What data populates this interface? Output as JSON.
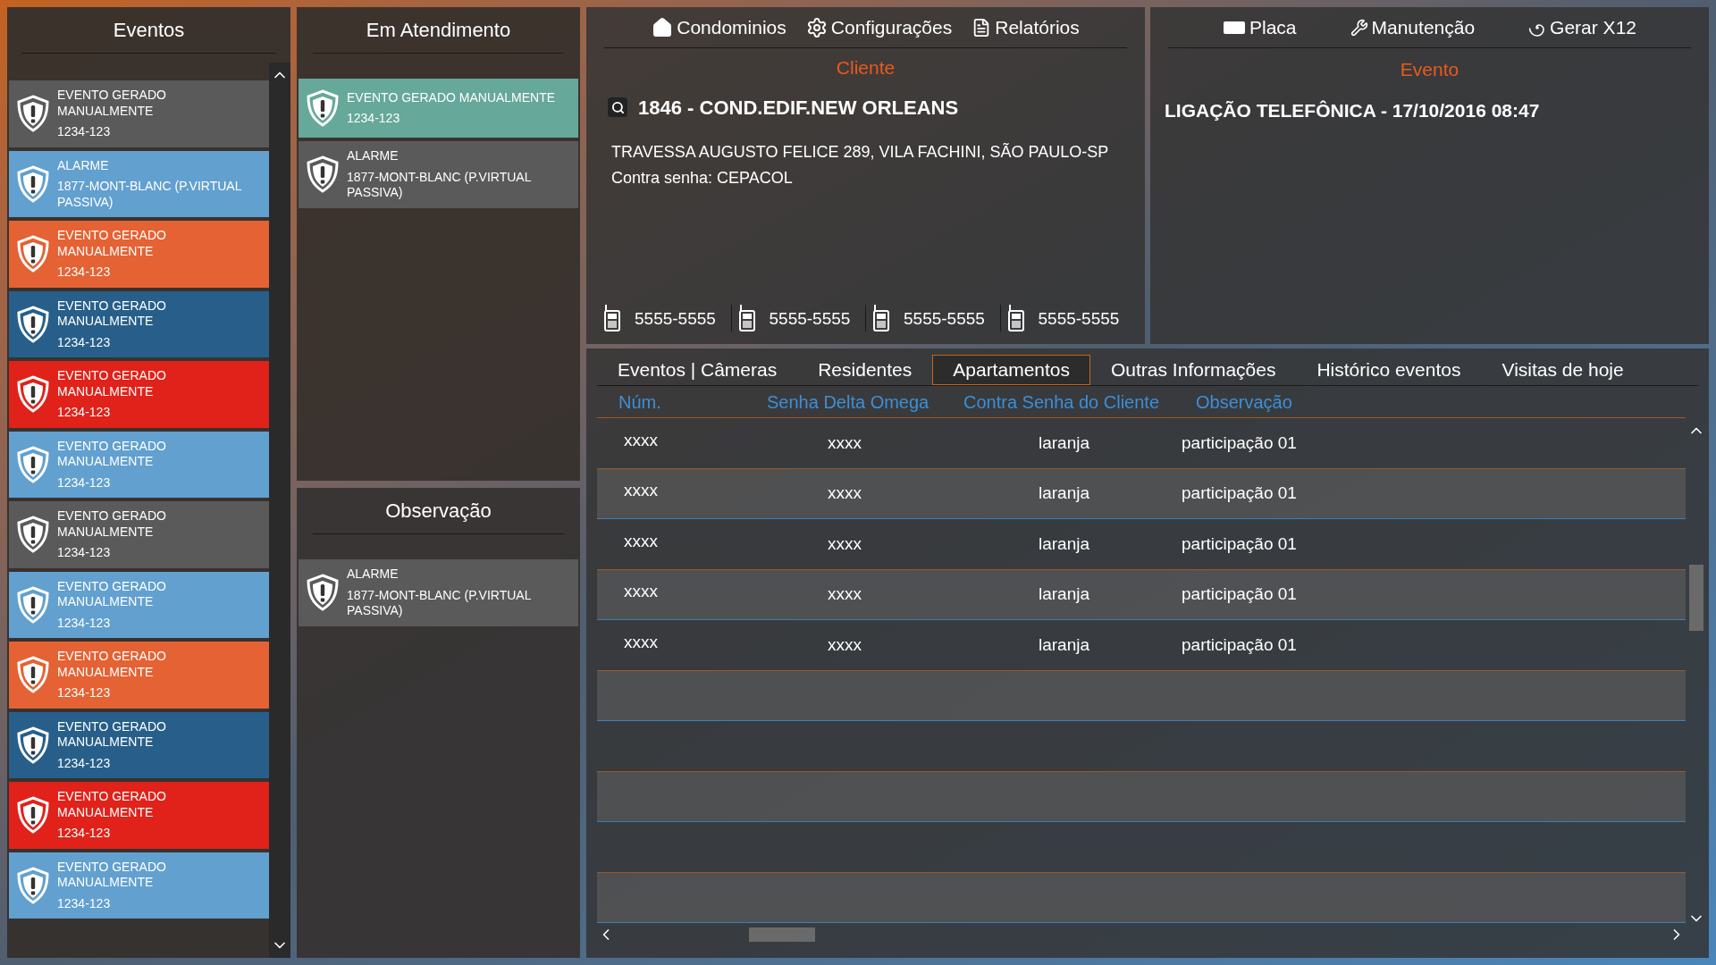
{
  "events_panel": {
    "title": "Eventos",
    "items": [
      {
        "title": "EVENTO GERADO MANUALMENTE",
        "code": "1234-123",
        "color": "#5a5a5a"
      },
      {
        "title": "ALARME",
        "code": "1877-MONT-BLANC (P.VIRTUAL PASSIVA)",
        "color": "#62a0cf"
      },
      {
        "title": "EVENTO GERADO MANUALMENTE",
        "code": "1234-123",
        "color": "#e46233"
      },
      {
        "title": "EVENTO GERADO MANUALMENTE",
        "code": "1234-123",
        "color": "#275f8a"
      },
      {
        "title": "EVENTO GERADO MANUALMENTE",
        "code": "1234-123",
        "color": "#e0221a"
      },
      {
        "title": "EVENTO GERADO MANUALMENTE",
        "code": "1234-123",
        "color": "#62a0cf"
      },
      {
        "title": "EVENTO GERADO MANUALMENTE",
        "code": "1234-123",
        "color": "#5a5a5a"
      },
      {
        "title": "EVENTO GERADO MANUALMENTE",
        "code": "1234-123",
        "color": "#62a0cf"
      },
      {
        "title": "EVENTO GERADO MANUALMENTE",
        "code": "1234-123",
        "color": "#e46233"
      },
      {
        "title": "EVENTO GERADO MANUALMENTE",
        "code": "1234-123",
        "color": "#275f8a"
      },
      {
        "title": "EVENTO GERADO MANUALMENTE",
        "code": "1234-123",
        "color": "#e0221a"
      },
      {
        "title": "EVENTO GERADO MANUALMENTE",
        "code": "1234-123",
        "color": "#62a0cf"
      }
    ]
  },
  "in_service_panel": {
    "title": "Em Atendimento",
    "items": [
      {
        "title": "EVENTO GERADO MANUALMENTE",
        "code": "1234-123",
        "color": "#66a89a"
      },
      {
        "title": "ALARME",
        "code": "1877-MONT-BLANC (P.VIRTUAL PASSIVA)",
        "color": "#5a5a5a"
      }
    ]
  },
  "observation_panel": {
    "title": "Observação",
    "items": [
      {
        "title": "ALARME",
        "code": "1877-MONT-BLANC (P.VIRTUAL PASSIVA)",
        "color": "#5a5a5a"
      }
    ]
  },
  "main_menu": [
    {
      "label": "Condominios",
      "kind": "home"
    },
    {
      "label": "Configurações",
      "kind": "gear"
    },
    {
      "label": "Relatórios",
      "kind": "report"
    }
  ],
  "client": {
    "heading": "Cliente",
    "name": "1846 - COND.EDIF.NEW ORLEANS",
    "address": "TRAVESSA AUGUSTO FELICE 289, VILA FACHINI, SÃO PAULO-SP",
    "password": "Contra senha: CEPACOL",
    "phones": [
      "5555-5555",
      "5555-5555",
      "5555-5555",
      "5555-5555"
    ]
  },
  "event_menu": [
    {
      "label": "Placa",
      "kind": "card"
    },
    {
      "label": "Manutenção",
      "kind": "wrench"
    },
    {
      "label": "Gerar X12",
      "kind": "spiral"
    }
  ],
  "event": {
    "heading": "Evento",
    "description": "LIGAÇÃO TELEFÔNICA - 17/10/2016 08:47"
  },
  "tabs": [
    {
      "label": "Eventos | Câmeras",
      "selected": false
    },
    {
      "label": "Residentes",
      "selected": false
    },
    {
      "label": "Apartamentos",
      "selected": true
    },
    {
      "label": "Outras Informações",
      "selected": false
    },
    {
      "label": "Histórico eventos",
      "selected": false
    },
    {
      "label": "Visitas de hoje",
      "selected": false
    }
  ],
  "table": {
    "columns": [
      "Núm.",
      "Senha Delta Omega",
      "Contra Senha do Cliente",
      "Observação"
    ],
    "rows": [
      [
        "xxxx",
        "xxxx",
        "laranja",
        "participação 01"
      ],
      [
        "xxxx",
        "xxxx",
        "laranja",
        "participação 01"
      ],
      [
        "xxxx",
        "xxxx",
        "laranja",
        "participação 01"
      ],
      [
        "xxxx",
        "xxxx",
        "laranja",
        "participação 01"
      ],
      [
        "xxxx",
        "xxxx",
        "laranja",
        "participação 01"
      ]
    ]
  }
}
